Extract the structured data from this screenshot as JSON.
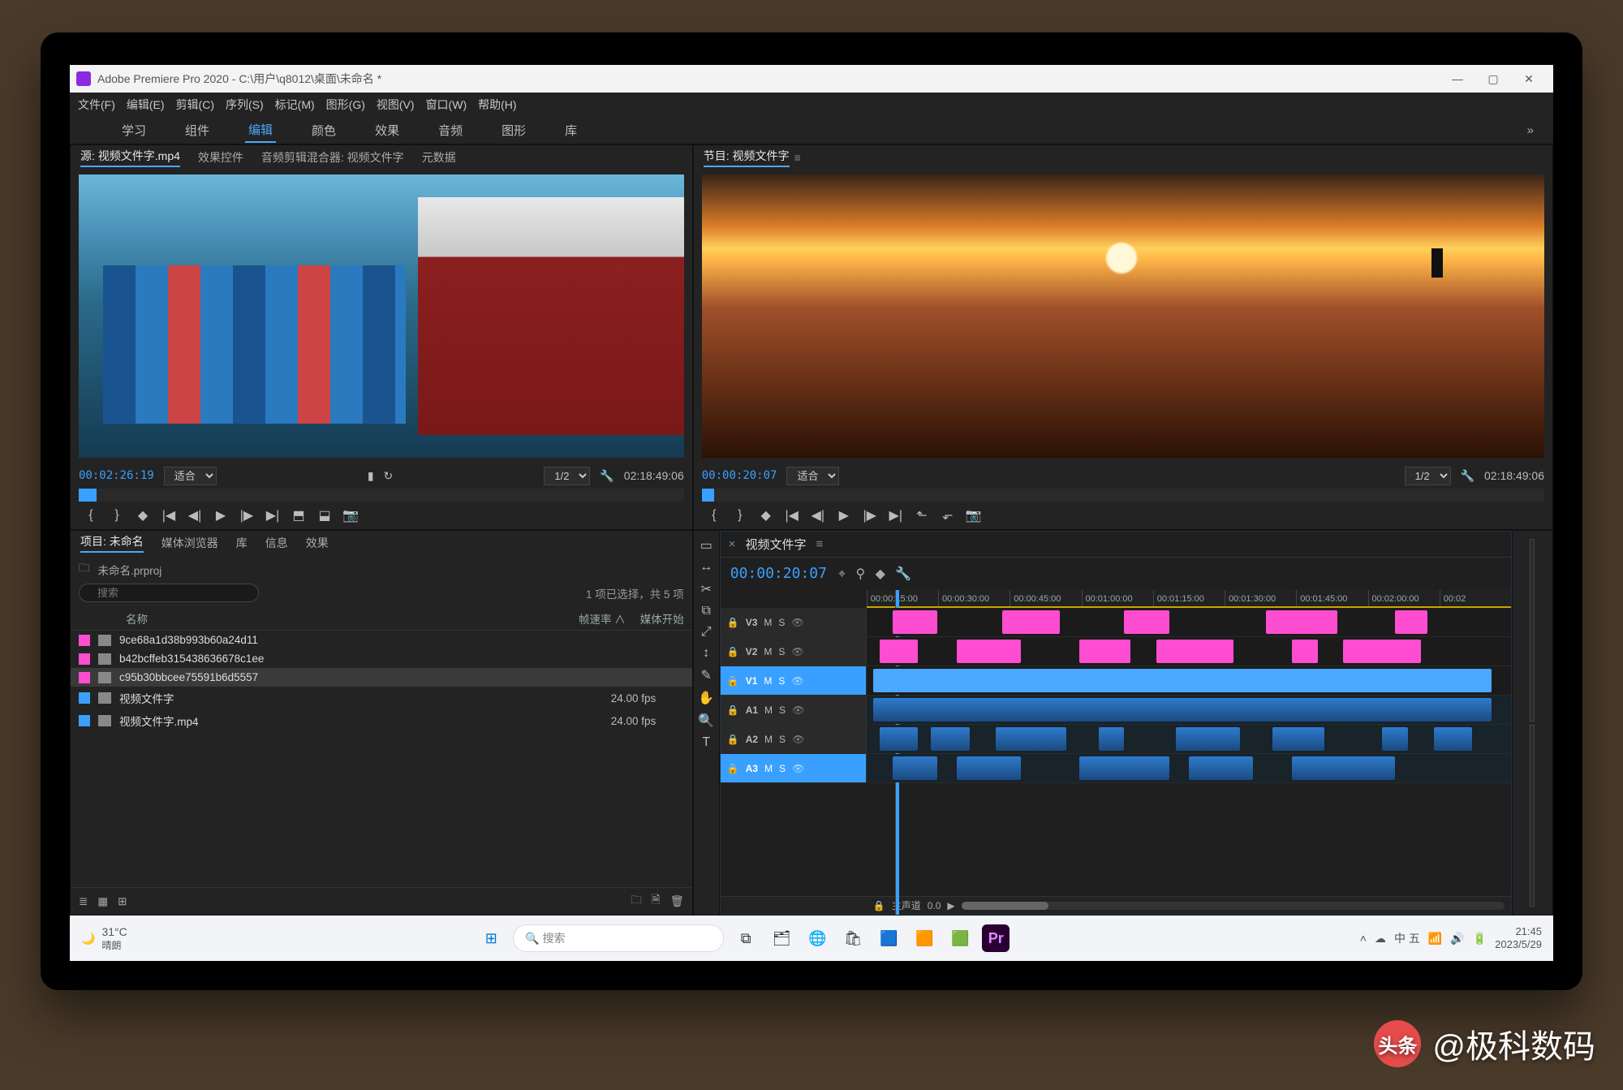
{
  "window": {
    "title": "Adobe Premiere Pro 2020 - C:\\用户\\q8012\\桌面\\未命名 *",
    "controls": {
      "min": "—",
      "max": "▢",
      "close": "✕"
    }
  },
  "menubar": [
    "文件(F)",
    "编辑(E)",
    "剪辑(C)",
    "序列(S)",
    "标记(M)",
    "图形(G)",
    "视图(V)",
    "窗口(W)",
    "帮助(H)"
  ],
  "workspaces": {
    "items": [
      "学习",
      "组件",
      "编辑",
      "颜色",
      "效果",
      "音频",
      "图形",
      "库"
    ],
    "active": 2,
    "more": "»"
  },
  "source_panel": {
    "tabs": [
      "源: 视频文件字.mp4",
      "效果控件",
      "音频剪辑混合器: 视频文件字",
      "元数据"
    ],
    "active": 0,
    "timecode": "00:02:26:19",
    "fit": "适合",
    "ratio": "1/2",
    "duration": "02:18:49:06"
  },
  "program_panel": {
    "title": "节目: 视频文件字",
    "timecode": "00:00:20:07",
    "fit": "适合",
    "ratio": "1/2",
    "duration": "02:18:49:06"
  },
  "project_panel": {
    "tabs": [
      "项目: 未命名",
      "媒体浏览器",
      "库",
      "信息",
      "效果"
    ],
    "active": 0,
    "breadcrumb": "未命名.prproj",
    "status": "1 项已选择，共 5 项",
    "search_placeholder": "搜索",
    "columns": [
      "",
      "名称",
      "帧速率 ∧",
      "媒体开始"
    ],
    "rows": [
      {
        "chip": "pink",
        "icon": "clip",
        "name": "9ce68a1d38b993b60a24d11",
        "fps": ""
      },
      {
        "chip": "pink",
        "icon": "clip",
        "name": "b42bcffeb315438636678c1ee",
        "fps": ""
      },
      {
        "chip": "pink",
        "icon": "clip",
        "name": "c95b30bbcee75591b6d5557",
        "fps": "",
        "selected": true
      },
      {
        "chip": "blue",
        "icon": "seq",
        "name": "视频文件字",
        "fps": "24.00 fps"
      },
      {
        "chip": "blue",
        "icon": "vid",
        "name": "视频文件字.mp4",
        "fps": "24.00 fps"
      }
    ]
  },
  "timeline": {
    "title": "视频文件字",
    "timecode": "00:00:20:07",
    "ruler": [
      "00:00:15:00",
      "00:00:30:00",
      "00:00:45:00",
      "00:01:00:00",
      "00:01:15:00",
      "00:01:30:00",
      "00:01:45:00",
      "00:02:00:00",
      "00:02"
    ],
    "master_label": "主声道",
    "master_value": "0.0",
    "tracks": [
      {
        "id": "V3",
        "type": "video",
        "clips": [
          [
            4,
            11,
            "pink"
          ],
          [
            21,
            30,
            "pink"
          ],
          [
            40,
            47,
            "pink"
          ],
          [
            62,
            73,
            "pink"
          ],
          [
            82,
            87,
            "pink"
          ]
        ]
      },
      {
        "id": "V2",
        "type": "video",
        "clips": [
          [
            2,
            8,
            "pink"
          ],
          [
            14,
            24,
            "pink"
          ],
          [
            33,
            41,
            "pink"
          ],
          [
            45,
            57,
            "pink"
          ],
          [
            66,
            70,
            "pink"
          ],
          [
            74,
            86,
            "pink"
          ]
        ]
      },
      {
        "id": "V1",
        "type": "video",
        "sel": true,
        "clips": [
          [
            1,
            97,
            "blue"
          ]
        ]
      },
      {
        "id": "A1",
        "type": "audio",
        "clips": [
          [
            1,
            97,
            "blue2"
          ]
        ]
      },
      {
        "id": "A2",
        "type": "audio",
        "clips": [
          [
            2,
            8,
            "cyan"
          ],
          [
            10,
            16,
            "cyan"
          ],
          [
            20,
            31,
            "cyan"
          ],
          [
            36,
            40,
            "cyan"
          ],
          [
            48,
            58,
            "cyan"
          ],
          [
            63,
            71,
            "cyan"
          ],
          [
            80,
            84,
            "cyan"
          ],
          [
            88,
            94,
            "cyan"
          ]
        ]
      },
      {
        "id": "A3",
        "type": "audio",
        "sel": true,
        "clips": [
          [
            4,
            11,
            "cyan"
          ],
          [
            14,
            24,
            "cyan"
          ],
          [
            33,
            47,
            "cyan"
          ],
          [
            50,
            60,
            "cyan"
          ],
          [
            66,
            82,
            "cyan"
          ]
        ]
      }
    ],
    "tools": [
      "▭",
      "↔",
      "✂",
      "⧉",
      "⤢",
      "↕",
      "✎",
      "✋",
      "🔍",
      "T"
    ]
  },
  "taskbar": {
    "weather_temp": "31°C",
    "weather_desc": "晴朗",
    "search_placeholder": "搜索",
    "tray": {
      "ime": "中 五",
      "time": "21:45",
      "date": "2023/5/29"
    }
  },
  "watermark": {
    "logo_text": "头条",
    "text": "@极科数码"
  }
}
